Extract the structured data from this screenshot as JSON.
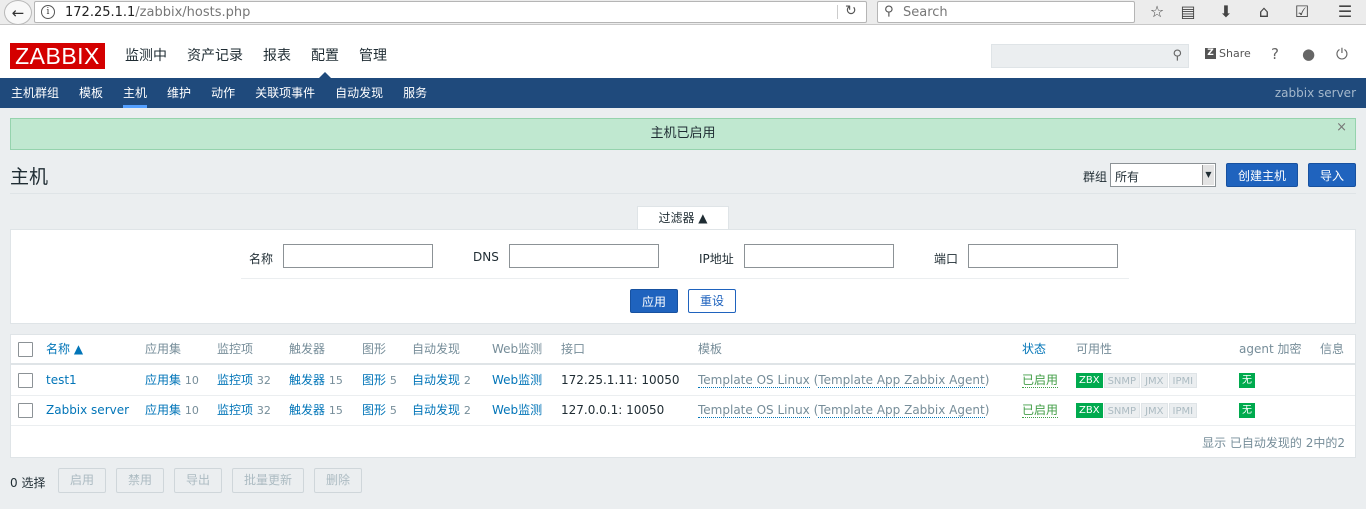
{
  "browser": {
    "url_host": "172.25.1.1",
    "url_path": "/zabbix/hosts.php",
    "search_placeholder": "Search"
  },
  "header": {
    "logo": "ZABBIX",
    "menu": [
      "监测中",
      "资产记录",
      "报表",
      "配置",
      "管理"
    ],
    "selected_menu": "配置",
    "share_label": "Share",
    "help_label": "?"
  },
  "submenu": {
    "items": [
      "主机群组",
      "模板",
      "主机",
      "维护",
      "动作",
      "关联项事件",
      "自动发现",
      "服务"
    ],
    "selected": "主机",
    "server_name": "zabbix server"
  },
  "message": {
    "text": "主机已启用",
    "close": "×"
  },
  "page": {
    "title": "主机",
    "group_label": "群组",
    "group_value": "所有",
    "create_button": "创建主机",
    "import_button": "导入"
  },
  "filter": {
    "tab_label": "过滤器 ▲",
    "name_label": "名称",
    "dns_label": "DNS",
    "ip_label": "IP地址",
    "port_label": "端口",
    "apply_button": "应用",
    "reset_button": "重设"
  },
  "table": {
    "headers": [
      "名称 ▲",
      "应用集",
      "监控项",
      "触发器",
      "图形",
      "自动发现",
      "Web监测",
      "接口",
      "模板",
      "状态",
      "可用性",
      "agent 加密",
      "信息"
    ],
    "rows": [
      {
        "name": "test1",
        "app_label": "应用集",
        "app_count": "10",
        "item_label": "监控项",
        "item_count": "32",
        "trigger_label": "触发器",
        "trigger_count": "15",
        "graph_label": "图形",
        "graph_count": "5",
        "discovery_label": "自动发现",
        "discovery_count": "2",
        "web_label": "Web监测",
        "interface": "172.25.1.11: 10050",
        "template": "Template OS Linux",
        "template_parent": "Template App Zabbix Agent",
        "status": "已启用",
        "zbx": "ZBX",
        "snmp": "SNMP",
        "jmx": "JMX",
        "ipmi": "IPMI",
        "encryption": "无"
      },
      {
        "name": "Zabbix server",
        "app_label": "应用集",
        "app_count": "10",
        "item_label": "监控项",
        "item_count": "32",
        "trigger_label": "触发器",
        "trigger_count": "15",
        "graph_label": "图形",
        "graph_count": "5",
        "discovery_label": "自动发现",
        "discovery_count": "2",
        "web_label": "Web监测",
        "interface": "127.0.0.1: 10050",
        "template": "Template OS Linux",
        "template_parent": "Template App Zabbix Agent",
        "status": "已启用",
        "zbx": "ZBX",
        "snmp": "SNMP",
        "jmx": "JMX",
        "ipmi": "IPMI",
        "encryption": "无"
      }
    ],
    "footer": "显示 已自动发现的 2中的2"
  },
  "actions": {
    "selected_count": "0 选择",
    "buttons": [
      "启用",
      "禁用",
      "导出",
      "批量更新",
      "删除"
    ]
  },
  "colors": {
    "header_blue": "#1f4a7c",
    "logo_red": "#d40000",
    "link": "#0275b8",
    "success_bg": "#c0e8d0",
    "enabled_green": "#429e47",
    "badge_green": "#00aa4e"
  }
}
